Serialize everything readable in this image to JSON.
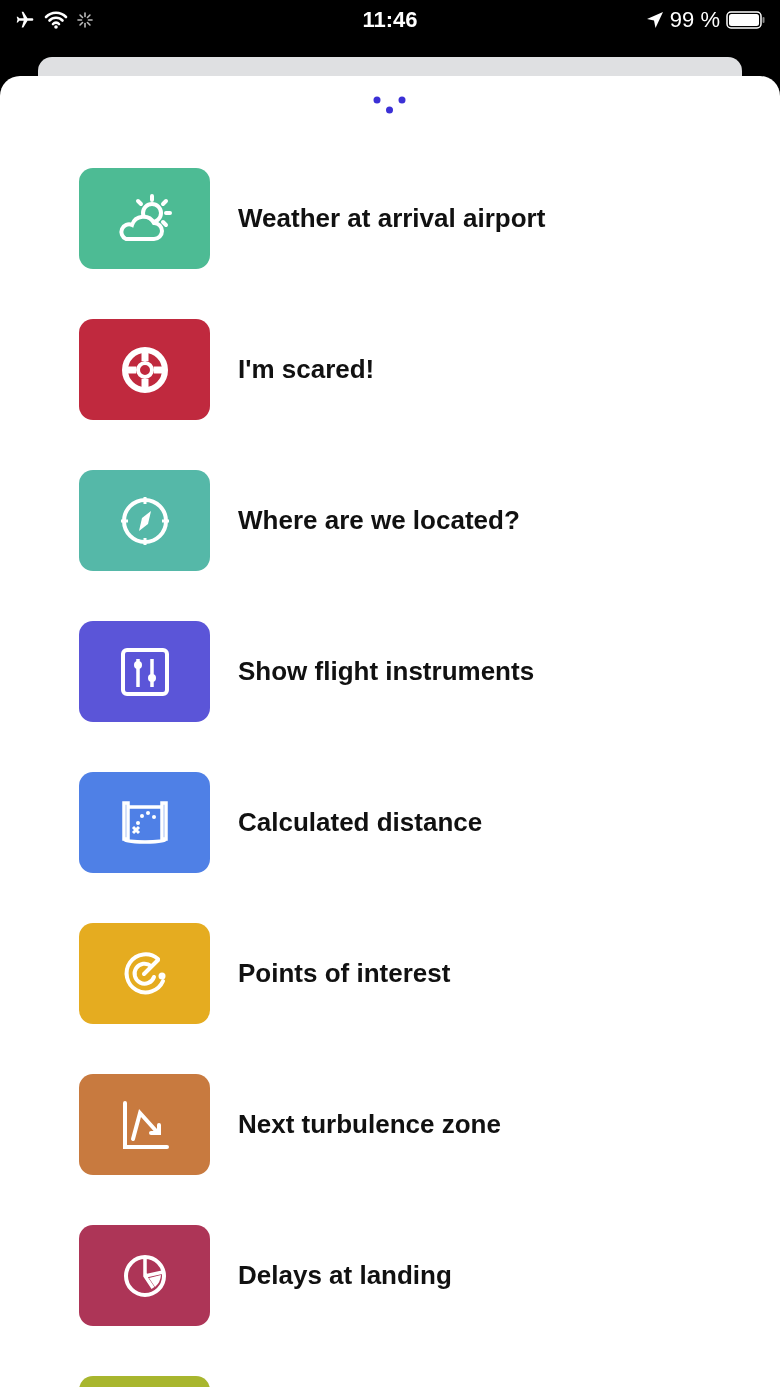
{
  "status_bar": {
    "time": "11:46",
    "battery": "99 %"
  },
  "menu_items": [
    {
      "label": "Weather at arrival airport",
      "kind": "weather",
      "color": "#4dbb94"
    },
    {
      "label": "I'm scared!",
      "kind": "lifebuoy",
      "color": "#c0293e"
    },
    {
      "label": "Where are we located?",
      "kind": "compass",
      "color": "#55b8a8"
    },
    {
      "label": "Show flight instruments",
      "kind": "sliders",
      "color": "#5b55d8"
    },
    {
      "label": "Calculated distance",
      "kind": "map",
      "color": "#4f80e6"
    },
    {
      "label": "Points of interest",
      "kind": "target",
      "color": "#e5ac20"
    },
    {
      "label": "Next turbulence zone",
      "kind": "chart",
      "color": "#c87a3f"
    },
    {
      "label": "Delays at landing",
      "kind": "pie",
      "color": "#ad3557"
    },
    {
      "color": "#a8b62e"
    }
  ]
}
